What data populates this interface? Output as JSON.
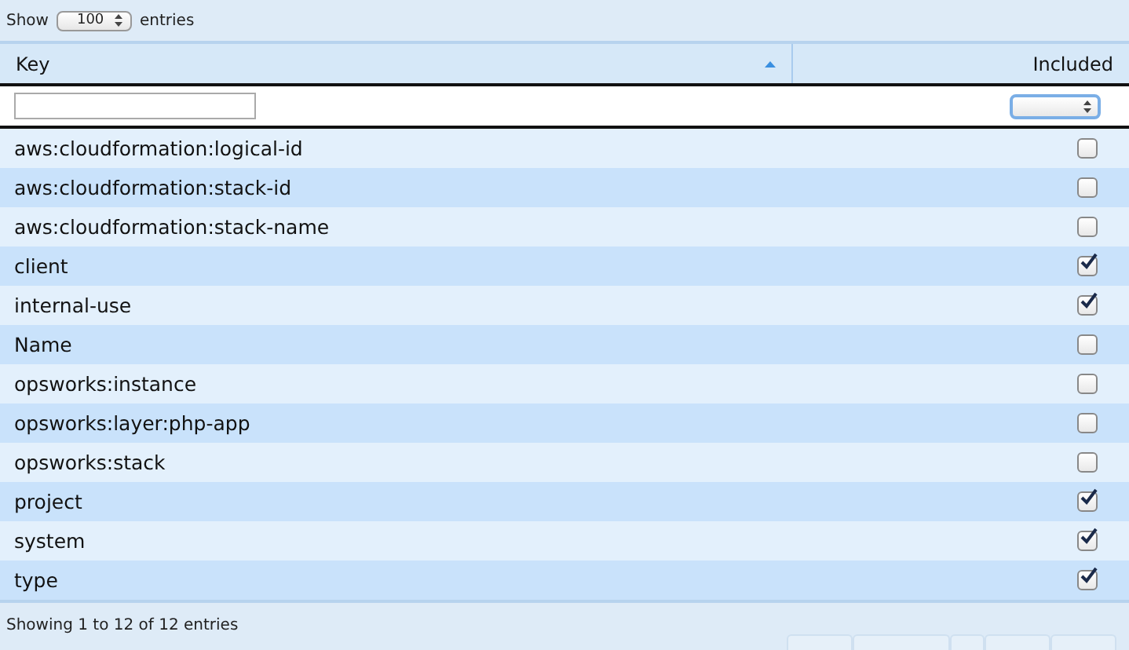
{
  "length_menu": {
    "label_before": "Show",
    "value": "100",
    "label_after": "entries"
  },
  "table": {
    "columns": [
      {
        "label": "Key",
        "sorted": true
      },
      {
        "label": "Included",
        "sorted": false
      }
    ],
    "rows": [
      {
        "key": "aws:cloudformation:logical-id",
        "included": false
      },
      {
        "key": "aws:cloudformation:stack-id",
        "included": false
      },
      {
        "key": "aws:cloudformation:stack-name",
        "included": false
      },
      {
        "key": "client",
        "included": true
      },
      {
        "key": "internal-use",
        "included": true
      },
      {
        "key": "Name",
        "included": false
      },
      {
        "key": "opsworks:instance",
        "included": false
      },
      {
        "key": "opsworks:layer:php-app",
        "included": false
      },
      {
        "key": "opsworks:stack",
        "included": false
      },
      {
        "key": "project",
        "included": true
      },
      {
        "key": "system",
        "included": true
      },
      {
        "key": "type",
        "included": true
      }
    ]
  },
  "info": "Showing 1 to 12 of 12 entries"
}
